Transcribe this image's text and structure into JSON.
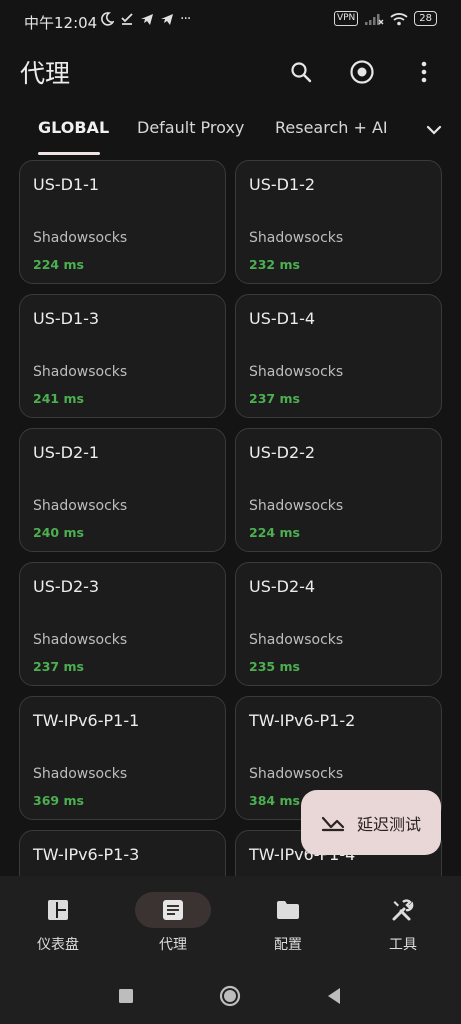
{
  "status_bar": {
    "time": "中午12:04",
    "vpn": "VPN",
    "battery": "28",
    "icons": [
      "moon-icon",
      "download-done-icon",
      "telegram-icon",
      "telegram-icon",
      "more-dots-icon",
      "vpn-icon",
      "signal-icon",
      "wifi-icon",
      "battery-icon"
    ]
  },
  "app_bar": {
    "title": "代理",
    "actions": [
      "search-icon",
      "target-icon",
      "more-vert-icon"
    ]
  },
  "tabs": {
    "items": [
      {
        "label": "GLOBAL",
        "active": true
      },
      {
        "label": "Default Proxy",
        "active": false
      },
      {
        "label": "Research + AI",
        "active": false
      }
    ],
    "more_icon": "chevron-down-icon"
  },
  "proxies": [
    {
      "name": "US-D1-1",
      "type": "Shadowsocks",
      "delay": "224 ms"
    },
    {
      "name": "US-D1-2",
      "type": "Shadowsocks",
      "delay": "232 ms"
    },
    {
      "name": "US-D1-3",
      "type": "Shadowsocks",
      "delay": "241 ms"
    },
    {
      "name": "US-D1-4",
      "type": "Shadowsocks",
      "delay": "237 ms"
    },
    {
      "name": "US-D2-1",
      "type": "Shadowsocks",
      "delay": "240 ms"
    },
    {
      "name": "US-D2-2",
      "type": "Shadowsocks",
      "delay": "224 ms"
    },
    {
      "name": "US-D2-3",
      "type": "Shadowsocks",
      "delay": "237 ms"
    },
    {
      "name": "US-D2-4",
      "type": "Shadowsocks",
      "delay": "235 ms"
    },
    {
      "name": "TW-IPv6-P1-1",
      "type": "Shadowsocks",
      "delay": "369 ms"
    },
    {
      "name": "TW-IPv6-P1-2",
      "type": "Shadowsocks",
      "delay": "384 ms"
    },
    {
      "name": "TW-IPv6-P1-3",
      "type": "",
      "delay": ""
    },
    {
      "name": "TW-IPv6-P1-4",
      "type": "",
      "delay": ""
    }
  ],
  "fab": {
    "label": "延迟测试",
    "icon": "speed-test-icon"
  },
  "bottom_nav": [
    {
      "label": "仪表盘",
      "icon": "dashboard-icon",
      "active": false
    },
    {
      "label": "代理",
      "icon": "article-icon",
      "active": true
    },
    {
      "label": "配置",
      "icon": "folder-icon",
      "active": false
    },
    {
      "label": "工具",
      "icon": "tools-icon",
      "active": false
    }
  ],
  "colors": {
    "background": "#141414",
    "card": "#1c1c1c",
    "card_border": "#3a3a3a",
    "delay_good": "#4caf50",
    "fab": "#e9d6d6",
    "nav_bg": "#1f1f1f",
    "nav_active_pill": "#3a3332"
  }
}
